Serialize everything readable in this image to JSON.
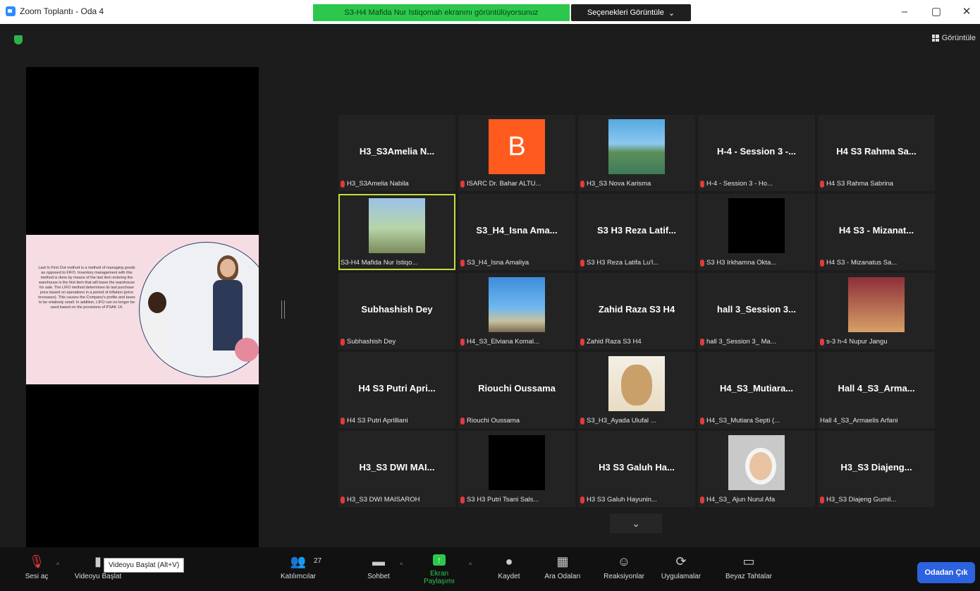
{
  "window": {
    "title": "Zoom Toplantı - Oda 4",
    "minimize": "–",
    "maximize": "▢",
    "close": "✕"
  },
  "share_banner": "S3-H4 Mafida Nur Istiqomah ekranını görüntülüyorsunuz",
  "view_options": {
    "label": "Seçenekleri Görüntüle",
    "caret": "⌄"
  },
  "view_button": "Görüntüle",
  "slide": {
    "text": "Last In First Out method is a method of managing goods as opposed to FIFO. Inventory management with this method is done by means of the last item entering the warehouse is the first item that will leave the warehouse for sale. The LIFO method determines its last purchase price based on operations in a period of inflation (price increases). This causes the Company's profits and taxes to be relatively small. In addition, LIFO can no longer be used based on the provisions of PSAK 14."
  },
  "gallery": [
    {
      "big": "H3_S3Amelia N...",
      "label": "H3_S3Amelia Nabila",
      "thumb": "",
      "muted": true
    },
    {
      "big": "",
      "label": "ISARC Dr. Bahar ALTU...",
      "thumb": "avatar-b",
      "avatar_letter": "B",
      "muted": true
    },
    {
      "big": "",
      "label": "H3_S3 Nova Karisma",
      "thumb": "t-sea",
      "muted": true
    },
    {
      "big": "H-4 - Session 3 -...",
      "label": "H-4 - Session 3 - Ho...",
      "thumb": "",
      "muted": true
    },
    {
      "big": "H4 S3 Rahma Sa...",
      "label": "H4 S3 Rahma Sabrina",
      "thumb": "",
      "muted": true
    },
    {
      "big": "",
      "label": "S3-H4 Mafida Nur Istiqo...",
      "thumb": "t-ferris",
      "muted": false,
      "active": true
    },
    {
      "big": "S3_H4_Isna Ama...",
      "label": "S3_H4_Isna Amaliya",
      "thumb": "",
      "muted": true
    },
    {
      "big": "S3 H3 Reza Latif...",
      "label": "S3 H3 Reza Latifa Lu'l...",
      "thumb": "",
      "muted": true
    },
    {
      "big": "",
      "label": "S3 H3 Irkhamna Okta...",
      "thumb": "t-black",
      "muted": true
    },
    {
      "big": "H4 S3 - Mizanat...",
      "label": "H4 S3 - Mizanatus Sa...",
      "thumb": "",
      "muted": true
    },
    {
      "big": "Subhashish Dey",
      "label": "Subhashish Dey",
      "thumb": "",
      "muted": true
    },
    {
      "big": "",
      "label": "H4_S3_Elviana Komal...",
      "thumb": "t-sea2",
      "muted": true
    },
    {
      "big": "Zahid Raza S3 H4",
      "label": "Zahid Raza S3 H4",
      "thumb": "",
      "muted": true
    },
    {
      "big": "hall 3_Session 3...",
      "label": "hall 3_Session 3_ Ma...",
      "thumb": "",
      "muted": true
    },
    {
      "big": "",
      "label": "s-3 h-4 Nupur Jangu",
      "thumb": "t-girl",
      "muted": true
    },
    {
      "big": "H4 S3 Putri Apri...",
      "label": "H4 S3 Putri Aprilliani",
      "thumb": "",
      "muted": true
    },
    {
      "big": "Riouchi Oussama",
      "label": "Riouchi Oussama",
      "thumb": "",
      "muted": true
    },
    {
      "big": "",
      "label": "S3_H3_Ayada Ulufal ...",
      "thumb": "t-bear",
      "muted": true
    },
    {
      "big": "H4_S3_Mutiara...",
      "label": "H4_S3_Mutiara Septi (...",
      "thumb": "",
      "muted": true
    },
    {
      "big": "Hall 4_S3_Arma...",
      "label": "Hall 4_S3_Armaelis Arfani",
      "thumb": "",
      "muted": false
    },
    {
      "big": "H3_S3 DWI MAI...",
      "label": "H3_S3 DWI MAISAROH",
      "thumb": "",
      "muted": true
    },
    {
      "big": "",
      "label": "S3 H3 Putri Tsani Sals...",
      "thumb": "t-black",
      "muted": true
    },
    {
      "big": "H3 S3 Galuh Ha...",
      "label": "H3 S3 Galuh Hayunin...",
      "thumb": "",
      "muted": true
    },
    {
      "big": "",
      "label": "H4_S3_ Ajun Nurul Afa",
      "thumb": "t-hijab",
      "muted": true
    },
    {
      "big": "H3_S3 Diajeng...",
      "label": "H3_S3 Diajeng Gumil...",
      "thumb": "",
      "muted": true
    }
  ],
  "gallery_scroll": "⌄",
  "toolbar": {
    "audio": "Sesi aç",
    "video": "Videoyu Başlat",
    "video_tooltip": "Videoyu Başlat (Alt+V)",
    "participants": "Katılımcılar",
    "participant_count": "27",
    "chat": "Sohbet",
    "share": "Ekran Paylaşımı",
    "record": "Kaydet",
    "breakout": "Ara Odaları",
    "reactions": "Reaksiyonlar",
    "apps": "Uygulamalar",
    "whiteboard": "Beyaz Tahtalar",
    "leave": "Odadan Çık"
  }
}
